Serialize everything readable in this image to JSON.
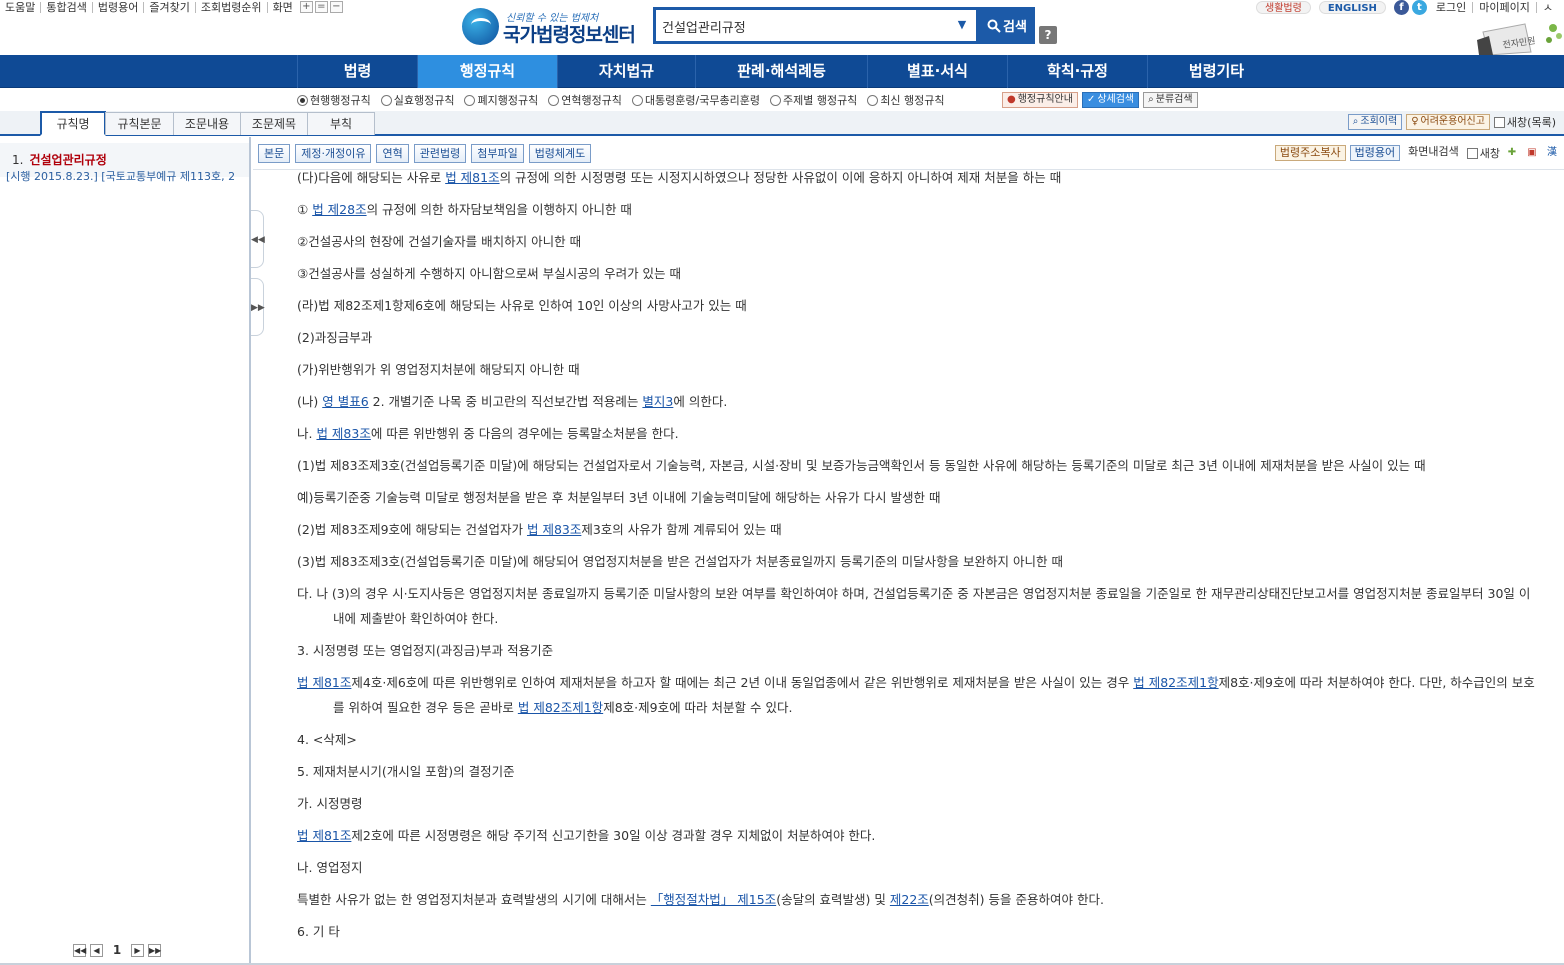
{
  "util": {
    "links": [
      "도움말",
      "통합검색",
      "법령용어",
      "즐겨찾기",
      "조회법령순위",
      "화면"
    ],
    "zoom": [
      "+",
      "=",
      "−"
    ]
  },
  "logo": {
    "slogan": "신뢰할 수 있는 법제처",
    "name": "국가법령정보센터"
  },
  "search": {
    "value": "건설업관리규정",
    "button": "검색",
    "help": "?"
  },
  "right_links": {
    "life": "생활법령",
    "english": "ENGLISH",
    "fb": "f",
    "tw": "t",
    "login": "로그인",
    "mypage": "마이페이지",
    "extra": "ㅅ"
  },
  "deco_text": "전자민원",
  "gnb": [
    {
      "label": "법령",
      "w": 120
    },
    {
      "label": "행정규칙",
      "w": 140,
      "active": true
    },
    {
      "label": "자치법규",
      "w": 138
    },
    {
      "label": "판례·해석례등",
      "w": 172
    },
    {
      "label": "별표·서식",
      "w": 140
    },
    {
      "label": "학칙·규정",
      "w": 140
    },
    {
      "label": "법령기타",
      "w": 138
    }
  ],
  "radios": [
    "현행행정규칙",
    "실효행정규칙",
    "폐지행정규칙",
    "연혁행정규칙",
    "대통령훈령/국무총리훈령",
    "주제별 행정규칙",
    "최신 행정규칙"
  ],
  "sub_buttons": [
    "행정규칙안내",
    "상세검색",
    "분류검색"
  ],
  "tabs": [
    "규칙명",
    "규칙본문",
    "조문내용",
    "조문제목",
    "부칙"
  ],
  "tab_right": {
    "history": "조회이력",
    "hard_terms": "어려운용어신고",
    "new_window": "새창(목록)"
  },
  "left": {
    "num": "1.",
    "title": "건설업관리규정",
    "sub": "[시행 2015.8.23.] [국토교통부예규 제113호, 2",
    "page": "1"
  },
  "toolbar_left": [
    "본문",
    "제정·개정이유",
    "연혁",
    "관련법령",
    "첨부파일",
    "법령체계도"
  ],
  "toolbar_right": {
    "copy": "법령주소복사",
    "terms": "법령용어",
    "screen_search": "화면내검색",
    "new_window": "새창"
  },
  "content": [
    {
      "segs": [
        {
          "t": "(다)다음에 해당되는 사유로 "
        },
        {
          "t": "법 제81조",
          "link": true
        },
        {
          "t": "의 규정에 의한 시정명령 또는 시정지시하였으나 정당한 사유없이 이에 응하지 아니하여 제재 처분을 하는 때"
        }
      ]
    },
    {
      "segs": [
        {
          "t": "① "
        },
        {
          "t": "법 제28조",
          "link": true
        },
        {
          "t": "의 규정에 의한 하자담보책임을 이행하지 아니한 때"
        }
      ]
    },
    {
      "segs": [
        {
          "t": "②건설공사의 현장에 건설기술자를 배치하지 아니한 때"
        }
      ]
    },
    {
      "segs": [
        {
          "t": "③건설공사를 성실하게 수행하지 아니함으로써 부실시공의 우려가 있는 때"
        }
      ]
    },
    {
      "segs": [
        {
          "t": "(라)법 제82조제1항제6호에 해당되는 사유로 인하여 10인 이상의 사망사고가 있는 때"
        }
      ]
    },
    {
      "segs": [
        {
          "t": "(2)과징금부과"
        }
      ]
    },
    {
      "segs": [
        {
          "t": "(가)위반행위가 위 영업정지처분에 해당되지 아니한 때"
        }
      ]
    },
    {
      "segs": [
        {
          "t": "(나) "
        },
        {
          "t": "영 별표6",
          "link": true
        },
        {
          "t": " 2. 개별기준 나목 중 비고란의 직선보간법 적용례는 "
        },
        {
          "t": "별지3",
          "link": true
        },
        {
          "t": "에 의한다."
        }
      ]
    },
    {
      "segs": [
        {
          "t": "나. "
        },
        {
          "t": "법 제83조",
          "link": true
        },
        {
          "t": "에 따른 위반행위 중 다음의 경우에는 등록말소처분을 한다."
        }
      ]
    },
    {
      "wrap": true,
      "segs": [
        {
          "t": "(1)법 제83조제3호(건설업등록기준 미달)에 해당되는 건설업자로서 기술능력, 자본금, 시설·장비 및 보증가능금액확인서 등 동일한 사유에 해당하는 등록기준의 미달로 최근 3년 이내에 제재처분을 받은 사실이 있는 때"
        }
      ]
    },
    {
      "segs": [
        {
          "t": "예)등록기준중 기술능력 미달로 행정처분을 받은 후 처분일부터 3년 이내에 기술능력미달에 해당하는 사유가 다시 발생한 때"
        }
      ]
    },
    {
      "segs": [
        {
          "t": "(2)법 제83조제9호에 해당되는 건설업자가 "
        },
        {
          "t": "법 제83조",
          "link": true
        },
        {
          "t": "제3호의 사유가 함께 계류되어 있는 때"
        }
      ]
    },
    {
      "segs": [
        {
          "t": "(3)법 제83조제3호(건설업등록기준 미달)에 해당되어 영업정지처분을 받은 건설업자가 처분종료일까지 등록기준의 미달사항을 보완하지 아니한 때"
        }
      ]
    },
    {
      "wrap": true,
      "segs": [
        {
          "t": "다. 나 (3)의 경우 시·도지사등은 영업정지처분 종료일까지 등록기준 미달사항의 보완 여부를 확인하여야 하며, 건설업등록기준 중 자본금은 영업정지처분 종료일을 기준일로 한 재무관리상태진단보고서를 영업정지처분 종료일부터 30일 이내에 제출받아 확인하여야 한다."
        }
      ]
    },
    {
      "segs": [
        {
          "t": "3. 시정명령 또는 영업정지(과징금)부과 적용기준"
        }
      ]
    },
    {
      "wrap": true,
      "segs": [
        {
          "t": "법 제81조",
          "link": true
        },
        {
          "t": "제4호·제6호에 따른 위반행위로 인하여 제재처분을 하고자 할 때에는 최근 2년 이내 동일업종에서 같은 위반행위로 제재처분을 받은 사실이 있는 경우 "
        },
        {
          "t": "법 제82조제1항",
          "link": true
        },
        {
          "t": "제8호·제9호에 따라 처분하여야 한다. 다만, 하수급인의 보호를 위하여 필요한 경우 등은 곧바로 "
        },
        {
          "t": "법 제82조제1항",
          "link": true
        },
        {
          "t": "제8호·제9호에 따라 처분할 수 있다."
        }
      ]
    },
    {
      "segs": [
        {
          "t": "4. <삭제>"
        }
      ]
    },
    {
      "segs": [
        {
          "t": "5. 제재처분시기(개시일 포함)의 결정기준"
        }
      ]
    },
    {
      "segs": [
        {
          "t": "가. 시정명령"
        }
      ]
    },
    {
      "segs": [
        {
          "t": "법 제81조",
          "link": true
        },
        {
          "t": "제2호에 따른 시정명령은 해당 주기적 신고기한을 30일 이상 경과할 경우 지체없이 처분하여야 한다."
        }
      ]
    },
    {
      "segs": [
        {
          "t": "나. 영업정지"
        }
      ]
    },
    {
      "segs": [
        {
          "t": "특별한 사유가 없는 한 영업정지처분과 효력발생의 시기에 대해서는 "
        },
        {
          "t": "「행정절차법」 제15조",
          "link": true
        },
        {
          "t": "(송달의 효력발생) 및 "
        },
        {
          "t": "제22조",
          "link": true
        },
        {
          "t": "(의견청취) 등을 준용하여야 한다."
        }
      ]
    },
    {
      "segs": [
        {
          "t": "6. 기 타"
        }
      ]
    }
  ]
}
